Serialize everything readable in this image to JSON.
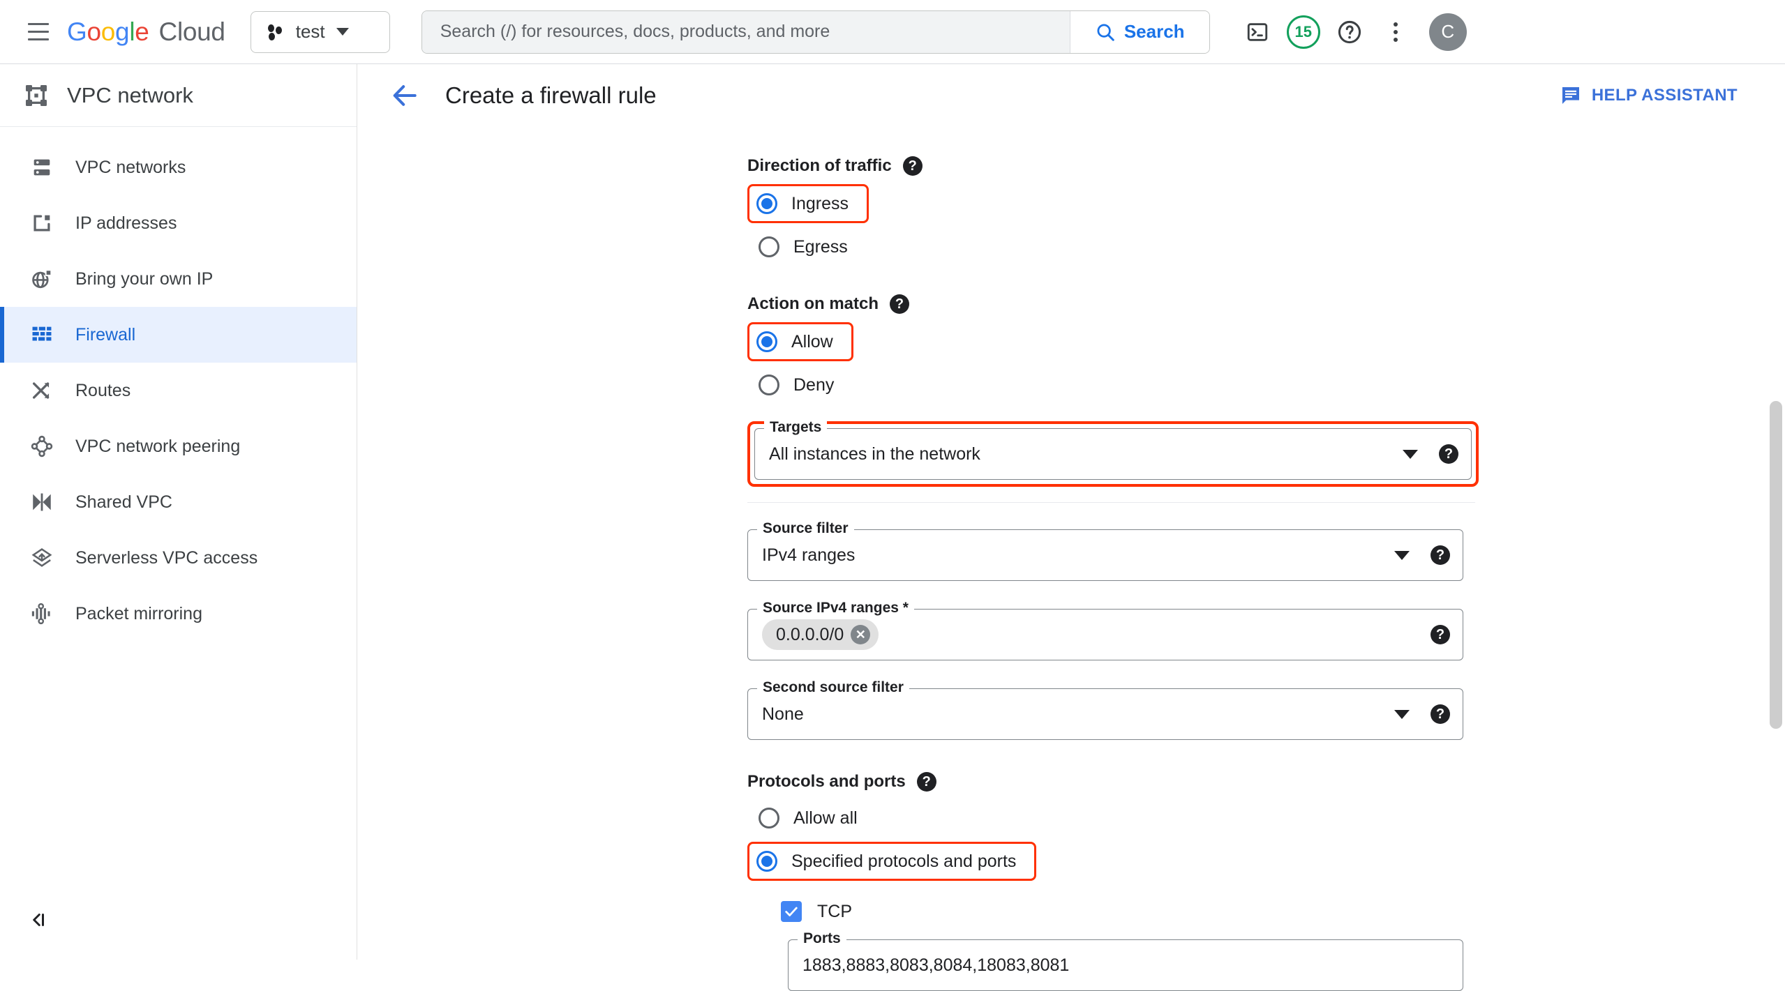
{
  "topbar": {
    "menu_icon": "hamburger-icon",
    "brand": {
      "google": "Google",
      "cloud": "Cloud"
    },
    "project_selector": {
      "label": "test",
      "icon": "project-dots-icon"
    },
    "search": {
      "placeholder": "Search (/) for resources, docs, products, and more",
      "value": "",
      "button_label": "Search",
      "icon": "search-icon"
    },
    "actions": [
      {
        "name": "cloud-shell-icon",
        "label": ""
      },
      {
        "name": "notifications-badge",
        "label": "15",
        "color": "#13A05C"
      },
      {
        "name": "help-icon",
        "label": ""
      },
      {
        "name": "more-options-icon",
        "label": ""
      }
    ],
    "avatar_letter": "C"
  },
  "sidebar": {
    "title": "VPC network",
    "title_icon": "vpc-network-icon",
    "items": [
      {
        "label": "VPC networks",
        "icon": "vpc-networks-icon",
        "active": false
      },
      {
        "label": "IP addresses",
        "icon": "ip-addresses-icon",
        "active": false
      },
      {
        "label": "Bring your own IP",
        "icon": "bring-your-own-ip-icon",
        "active": false
      },
      {
        "label": "Firewall",
        "icon": "firewall-icon",
        "active": true
      },
      {
        "label": "Routes",
        "icon": "routes-icon",
        "active": false
      },
      {
        "label": "VPC network peering",
        "icon": "vpc-network-peering-icon",
        "active": false
      },
      {
        "label": "Shared VPC",
        "icon": "shared-vpc-icon",
        "active": false
      },
      {
        "label": "Serverless VPC access",
        "icon": "serverless-vpc-access-icon",
        "active": false
      },
      {
        "label": "Packet mirroring",
        "icon": "packet-mirroring-icon",
        "active": false
      }
    ],
    "collapse_label": "",
    "collapse_icon": "collapse-sidebar-icon"
  },
  "page": {
    "back_icon": "back-arrow-icon",
    "title": "Create a firewall rule",
    "help_assistant": {
      "label": "HELP ASSISTANT",
      "icon": "help-assistant-icon"
    }
  },
  "form": {
    "direction": {
      "label": "Direction of traffic",
      "options": [
        {
          "label": "Ingress",
          "selected": true,
          "highlighted": true
        },
        {
          "label": "Egress",
          "selected": false,
          "highlighted": false
        }
      ]
    },
    "action_on_match": {
      "label": "Action on match",
      "options": [
        {
          "label": "Allow",
          "selected": true,
          "highlighted": true
        },
        {
          "label": "Deny",
          "selected": false,
          "highlighted": false
        }
      ]
    },
    "targets": {
      "legend": "Targets",
      "value": "All instances in the network",
      "highlighted": true
    },
    "source_filter": {
      "legend": "Source filter",
      "value": "IPv4 ranges"
    },
    "source_ipv4_ranges": {
      "legend": "Source IPv4 ranges *",
      "chips": [
        "0.0.0.0/0"
      ]
    },
    "second_source_filter": {
      "legend": "Second source filter",
      "value": "None"
    },
    "protocols_and_ports": {
      "label": "Protocols and ports",
      "options": [
        {
          "label": "Allow all",
          "selected": false,
          "highlighted": false
        },
        {
          "label": "Specified protocols and ports",
          "selected": true,
          "highlighted": true
        }
      ],
      "tcp": {
        "label": "TCP",
        "checked": true
      },
      "ports": {
        "legend": "Ports",
        "value": "1883,8883,8083,8084,18083,8081"
      }
    }
  },
  "colors": {
    "accent_blue": "#1a73e8",
    "highlight_red": "#FF3000",
    "sidebar_active_bg": "#e8f0fe"
  }
}
